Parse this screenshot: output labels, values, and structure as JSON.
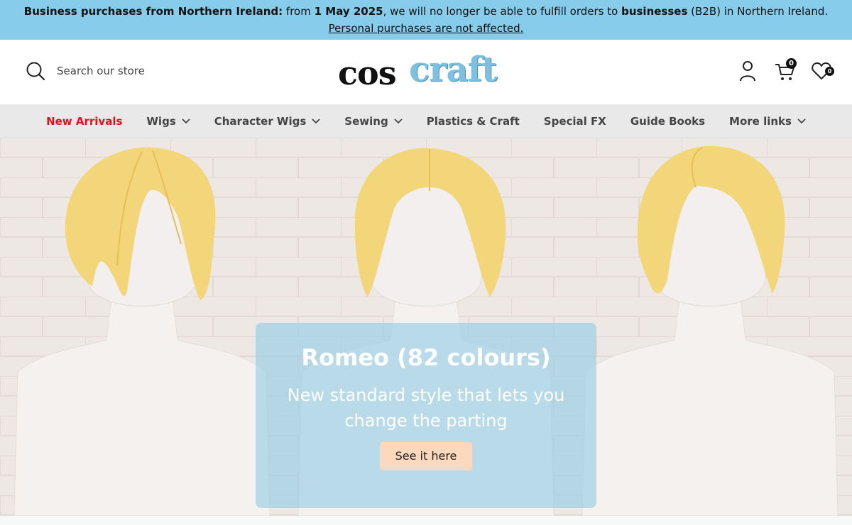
{
  "announcement": {
    "part1_bold": "Business purchases from Northern Ireland:",
    "part2": " from ",
    "part3_bold": "1 May 2025",
    "part4": ", we will no longer be able to fulfill orders to ",
    "part5_bold": "businesses",
    "part6": " (B2B) in Northern Ireland. ",
    "link": "Personal purchases are not affected."
  },
  "header": {
    "search_placeholder": "Search our store",
    "logo_part1": "cos",
    "logo_part2": "craft",
    "cart_count": "0",
    "wishlist_count": "0"
  },
  "nav": {
    "items": [
      {
        "label": "New Arrivals"
      },
      {
        "label": "Wigs"
      },
      {
        "label": "Character Wigs"
      },
      {
        "label": "Sewing"
      },
      {
        "label": "Plastics & Craft"
      },
      {
        "label": "Special FX"
      },
      {
        "label": "Guide Books"
      },
      {
        "label": "More links"
      }
    ]
  },
  "hero": {
    "title": "Romeo (82 colours)",
    "subtitle": "New standard style that lets you change the parting",
    "button": "See it here"
  },
  "colors": {
    "announcement_bg": "#87cdeb",
    "nav_bg": "#e9e9e9",
    "nav_highlight": "#e0121a",
    "overlay": "#9bcee6",
    "button_bg": "#fcd9bd",
    "wig": "#f3d67a"
  },
  "icons": [
    "search-icon",
    "account-icon",
    "cart-icon",
    "wishlist-icon",
    "chevron-down-icon"
  ]
}
